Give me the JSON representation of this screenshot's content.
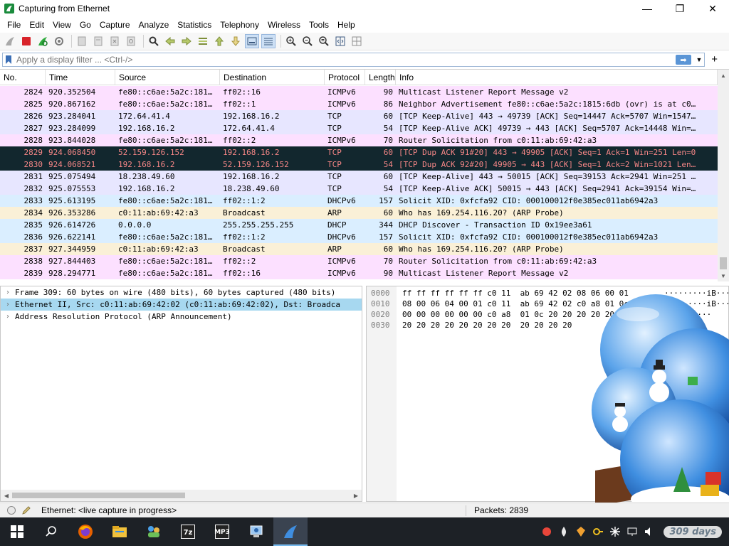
{
  "window": {
    "title": "Capturing from Ethernet",
    "minimize_glyph": "—",
    "maximize_glyph": "❐",
    "close_glyph": "✕"
  },
  "menu": [
    "File",
    "Edit",
    "View",
    "Go",
    "Capture",
    "Analyze",
    "Statistics",
    "Telephony",
    "Wireless",
    "Tools",
    "Help"
  ],
  "filter": {
    "placeholder": "Apply a display filter ... <Ctrl-/>",
    "apply_glyph": "➡",
    "dropdown_glyph": "▼",
    "add_glyph": "+"
  },
  "packet_list": {
    "columns": [
      "No.",
      "Time",
      "Source",
      "Destination",
      "Protocol",
      "Length",
      "Info"
    ],
    "rows": [
      {
        "no": "2824",
        "time": "920.352504",
        "src": "fe80::c6ae:5a2c:181…",
        "dst": "ff02::16",
        "proto": "ICMPv6",
        "len": "90",
        "info": "Multicast Listener Report Message v2",
        "kind": "icmp"
      },
      {
        "no": "2825",
        "time": "920.867162",
        "src": "fe80::c6ae:5a2c:181…",
        "dst": "ff02::1",
        "proto": "ICMPv6",
        "len": "86",
        "info": "Neighbor Advertisement fe80::c6ae:5a2c:1815:6db (ovr) is at c0…",
        "kind": "icmp"
      },
      {
        "no": "2826",
        "time": "923.284041",
        "src": "172.64.41.4",
        "dst": "192.168.16.2",
        "proto": "TCP",
        "len": "60",
        "info": "[TCP Keep-Alive] 443 → 49739 [ACK] Seq=14447 Ack=5707 Win=1547…",
        "kind": "tcp"
      },
      {
        "no": "2827",
        "time": "923.284099",
        "src": "192.168.16.2",
        "dst": "172.64.41.4",
        "proto": "TCP",
        "len": "54",
        "info": "[TCP Keep-Alive ACK] 49739 → 443 [ACK] Seq=5707 Ack=14448 Win=…",
        "kind": "tcp"
      },
      {
        "no": "2828",
        "time": "923.844028",
        "src": "fe80::c6ae:5a2c:181…",
        "dst": "ff02::2",
        "proto": "ICMPv6",
        "len": "70",
        "info": "Router Solicitation from c0:11:ab:69:42:a3",
        "kind": "icmp"
      },
      {
        "no": "2829",
        "time": "924.068450",
        "src": "52.159.126.152",
        "dst": "192.168.16.2",
        "proto": "TCP",
        "len": "60",
        "info": "[TCP Dup ACK 91#20] 443 → 49905 [ACK] Seq=1 Ack=1 Win=251 Len=0",
        "kind": "bad"
      },
      {
        "no": "2830",
        "time": "924.068521",
        "src": "192.168.16.2",
        "dst": "52.159.126.152",
        "proto": "TCP",
        "len": "54",
        "info": "[TCP Dup ACK 92#20] 49905 → 443 [ACK] Seq=1 Ack=2 Win=1021 Len…",
        "kind": "bad"
      },
      {
        "no": "2831",
        "time": "925.075494",
        "src": "18.238.49.60",
        "dst": "192.168.16.2",
        "proto": "TCP",
        "len": "60",
        "info": "[TCP Keep-Alive] 443 → 50015 [ACK] Seq=39153 Ack=2941 Win=251 …",
        "kind": "tcp"
      },
      {
        "no": "2832",
        "time": "925.075553",
        "src": "192.168.16.2",
        "dst": "18.238.49.60",
        "proto": "TCP",
        "len": "54",
        "info": "[TCP Keep-Alive ACK] 50015 → 443 [ACK] Seq=2941 Ack=39154 Win=…",
        "kind": "tcp"
      },
      {
        "no": "2833",
        "time": "925.613195",
        "src": "fe80::c6ae:5a2c:181…",
        "dst": "ff02::1:2",
        "proto": "DHCPv6",
        "len": "157",
        "info": "Solicit XID: 0xfcfa92 CID: 000100012f0e385ec011ab6942a3",
        "kind": "dhcp"
      },
      {
        "no": "2834",
        "time": "926.353286",
        "src": "c0:11:ab:69:42:a3",
        "dst": "Broadcast",
        "proto": "ARP",
        "len": "60",
        "info": "Who has 169.254.116.20? (ARP Probe)",
        "kind": "arp"
      },
      {
        "no": "2835",
        "time": "926.614726",
        "src": "0.0.0.0",
        "dst": "255.255.255.255",
        "proto": "DHCP",
        "len": "344",
        "info": "DHCP Discover - Transaction ID 0x19ee3a61",
        "kind": "dhcp"
      },
      {
        "no": "2836",
        "time": "926.622141",
        "src": "fe80::c6ae:5a2c:181…",
        "dst": "ff02::1:2",
        "proto": "DHCPv6",
        "len": "157",
        "info": "Solicit XID: 0xfcfa92 CID: 000100012f0e385ec011ab6942a3",
        "kind": "dhcp"
      },
      {
        "no": "2837",
        "time": "927.344959",
        "src": "c0:11:ab:69:42:a3",
        "dst": "Broadcast",
        "proto": "ARP",
        "len": "60",
        "info": "Who has 169.254.116.20? (ARP Probe)",
        "kind": "arp"
      },
      {
        "no": "2838",
        "time": "927.844403",
        "src": "fe80::c6ae:5a2c:181…",
        "dst": "ff02::2",
        "proto": "ICMPv6",
        "len": "70",
        "info": "Router Solicitation from c0:11:ab:69:42:a3",
        "kind": "icmp"
      },
      {
        "no": "2839",
        "time": "928.294771",
        "src": "fe80::c6ae:5a2c:181…",
        "dst": "ff02::16",
        "proto": "ICMPv6",
        "len": "90",
        "info": "Multicast Listener Report Message v2",
        "kind": "icmp"
      }
    ]
  },
  "details": [
    {
      "text": "Frame 309: 60 bytes on wire (480 bits), 60 bytes captured (480 bits)",
      "selected": false
    },
    {
      "text": "Ethernet II, Src: c0:11:ab:69:42:02 (c0:11:ab:69:42:02), Dst: Broadca",
      "selected": true
    },
    {
      "text": "Address Resolution Protocol (ARP Announcement)",
      "selected": false
    }
  ],
  "bytes": [
    {
      "offset": "0000",
      "hex": "ff ff ff ff ff ff c0 11  ab 69 42 02 08 06 00 01",
      "ascii": "·········iB·····"
    },
    {
      "offset": "0010",
      "hex": "08 00 06 04 00 01 c0 11  ab 69 42 02 c0 a8 01 0c",
      "ascii": "·········iB·····"
    },
    {
      "offset": "0020",
      "hex": "00 00 00 00 00 00 c0 a8  01 0c 20 20 20 20 20 20",
      "ascii": "··········      "
    },
    {
      "offset": "0030",
      "hex": "20 20 20 20 20 20 20 20  20 20 20 20",
      "ascii": "            "
    }
  ],
  "status": {
    "capture_text": "Ethernet: <live capture in progress>",
    "packets_text": "Packets: 2839"
  },
  "taskbar": {
    "days_badge": "309 days",
    "apps": [
      "firefox",
      "file-explorer",
      "network-app",
      "7zip",
      "mp3-app",
      "remote-app",
      "wireshark"
    ]
  },
  "colors": {
    "icmp_row": "#fce0ff",
    "tcp_row": "#e7e6ff",
    "dhcp_row": "#daeeff",
    "arp_row": "#faf0d7",
    "bad_row_bg": "#12272e",
    "bad_row_fg": "#f78787",
    "selected_detail": "#a7d8f0",
    "taskbar": "#1d2126"
  }
}
